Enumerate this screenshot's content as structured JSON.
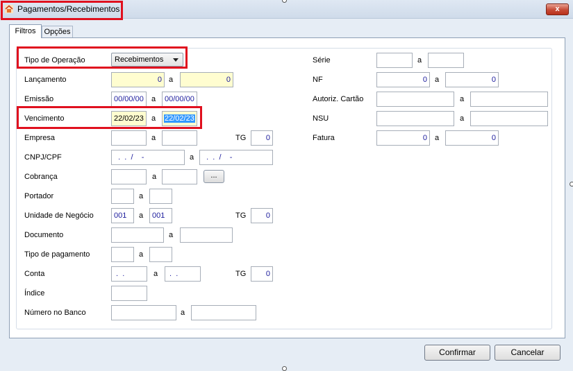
{
  "window": {
    "title": "Pagamentos/Recebimentos",
    "close_label": "x"
  },
  "tabs": [
    {
      "label": "Filtros"
    },
    {
      "label": "Opções"
    }
  ],
  "left": {
    "tipo_operacao": {
      "label": "Tipo de Operação",
      "value": "Recebimentos"
    },
    "lancamento": {
      "label": "Lançamento",
      "sep": "a",
      "from": "0",
      "to": "0"
    },
    "emissao": {
      "label": "Emissão",
      "sep": "a",
      "from": "00/00/00",
      "to": "00/00/00"
    },
    "vencimento": {
      "label": "Vencimento",
      "sep": "a",
      "from": "22/02/23",
      "to": "22/02/23"
    },
    "empresa": {
      "label": "Empresa",
      "sep": "a",
      "from": "",
      "to": "",
      "tg_label": "TG",
      "tg_value": "0"
    },
    "cnpj_cpf": {
      "label": "CNPJ/CPF",
      "sep": "a",
      "from": "  .  .  /    -",
      "to": "  .  .  /    -"
    },
    "cobranca": {
      "label": "Cobrança",
      "sep": "a",
      "from": "",
      "to": "",
      "button": "..."
    },
    "portador": {
      "label": "Portador",
      "sep": "a",
      "from": "",
      "to": ""
    },
    "unidade_negocio": {
      "label": "Unidade de Negócio",
      "sep": "a",
      "from": "001",
      "to": "001",
      "tg_label": "TG",
      "tg_value": "0"
    },
    "documento": {
      "label": "Documento",
      "sep": "a",
      "from": "",
      "to": ""
    },
    "tipo_pagamento": {
      "label": "Tipo de pagamento",
      "sep": "a",
      "from": "",
      "to": ""
    },
    "conta": {
      "label": "Conta",
      "sep": "a",
      "from": " .  .",
      "to": " .  .",
      "tg_label": "TG",
      "tg_value": "0"
    },
    "indice": {
      "label": "Índice",
      "value": ""
    },
    "numero_banco": {
      "label": "Número no Banco",
      "sep": "a",
      "from": "",
      "to": ""
    }
  },
  "right": {
    "serie": {
      "label": "Série",
      "sep": "a",
      "from": "",
      "to": ""
    },
    "nf": {
      "label": "NF",
      "sep": "a",
      "from": "0",
      "to": "0"
    },
    "autoriz_cartao": {
      "label": "Autoriz. Cartão",
      "sep": "a",
      "from": "",
      "to": ""
    },
    "nsu": {
      "label": "NSU",
      "sep": "a",
      "from": "",
      "to": ""
    },
    "fatura": {
      "label": "Fatura",
      "sep": "a",
      "from": "0",
      "to": "0"
    }
  },
  "buttons": {
    "confirm": "Confirmar",
    "cancel": "Cancelar"
  },
  "colors": {
    "highlight": "#e0101e",
    "input_text": "#1b1b9c",
    "required_bg": "#fffdd0",
    "selection": "#3399ff"
  }
}
